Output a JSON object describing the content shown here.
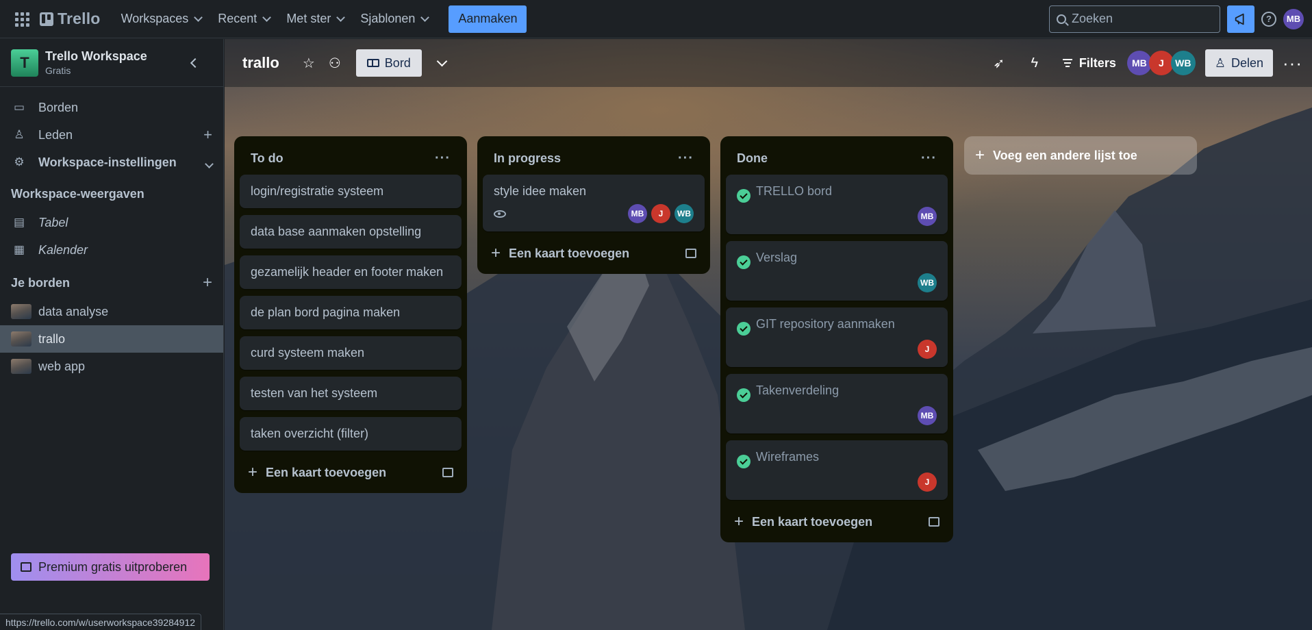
{
  "topbar": {
    "logo": "Trello",
    "nav": [
      "Workspaces",
      "Recent",
      "Met ster",
      "Sjablonen"
    ],
    "create": "Aanmaken",
    "search_placeholder": "Zoeken",
    "help": "?",
    "user_initials": "MB"
  },
  "sidebar": {
    "workspace_initial": "T",
    "workspace_name": "Trello Workspace",
    "workspace_plan": "Gratis",
    "items": {
      "boards": "Borden",
      "members": "Leden",
      "settings": "Workspace-instellingen"
    },
    "views_title": "Workspace-weergaven",
    "views": {
      "table": "Tabel",
      "calendar": "Kalender"
    },
    "your_boards_title": "Je borden",
    "boards": [
      "data analyse",
      "trallo",
      "web app"
    ],
    "premium": "Premium gratis uitproberen",
    "status_url": "https://trello.com/w/userworkspace39284912"
  },
  "board": {
    "title": "trallo",
    "view": "Bord",
    "filters": "Filters",
    "share": "Delen",
    "members": [
      "MB",
      "J",
      "WB"
    ]
  },
  "lists": [
    {
      "title": "To do",
      "cards": [
        "login/registratie systeem",
        "data base aanmaken opstelling",
        "gezamelijk header en footer maken",
        "de plan bord pagina maken",
        "curd systeem maken",
        "testen van het systeem",
        "taken overzicht (filter)"
      ],
      "add": "Een kaart toevoegen"
    },
    {
      "title": "In progress",
      "card": {
        "title": "style idee maken",
        "members": [
          "MB",
          "J",
          "WB"
        ]
      },
      "add": "Een kaart toevoegen"
    },
    {
      "title": "Done",
      "cards": [
        {
          "title": "TRELLO bord",
          "member": "MB"
        },
        {
          "title": "Verslag",
          "member": "WB"
        },
        {
          "title": "GIT repository aanmaken",
          "member": "J"
        },
        {
          "title": "Takenverdeling",
          "member": "MB"
        },
        {
          "title": "Wireframes",
          "member": "J"
        }
      ],
      "add": "Een kaart toevoegen"
    }
  ],
  "add_list": "Voeg een andere lijst toe",
  "colors": {
    "accent": "#579dff",
    "complete": "#4bce97",
    "member_mb": "#5e4db2",
    "member_j": "#c9372c",
    "member_wb": "#1d7f8c"
  }
}
